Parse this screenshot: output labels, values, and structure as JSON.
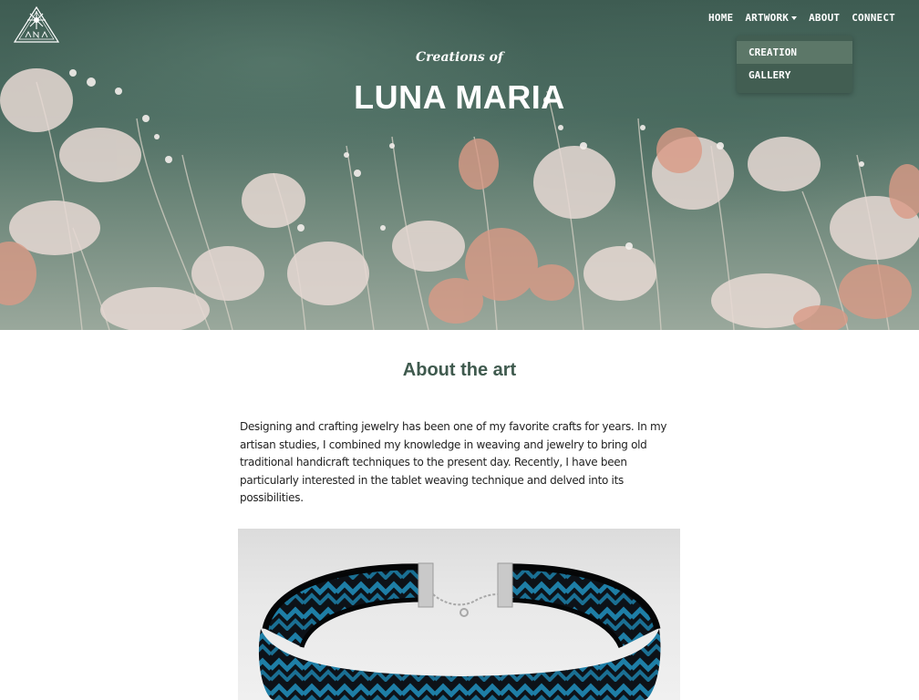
{
  "brand": {
    "logo_icon": "luna-maria-logo-icon"
  },
  "nav": {
    "items": [
      {
        "label": "HOME"
      },
      {
        "label": "ARTWORK",
        "has_dropdown": true
      },
      {
        "label": "ABOUT"
      },
      {
        "label": "CONNECT"
      }
    ],
    "dropdown": [
      {
        "label": "CREATION",
        "active": true
      },
      {
        "label": "GALLERY",
        "active": false
      }
    ]
  },
  "hero": {
    "tagline": "Creations of",
    "title": "LUNA MARIA"
  },
  "about": {
    "heading": "About the art",
    "body": "Designing and crafting jewelry has been one of my favorite crafts for years. In my artisan studies, I combined my knowledge in weaving and jewelry to bring old traditional handicraft techniques to the present day. Recently, I have been particularly interested in the tablet weaving technique and delved into its possibilities."
  },
  "colors": {
    "accent": "#3f5a4e",
    "dropdown_bg": "#425e52",
    "dropdown_active": "#5c7768"
  }
}
